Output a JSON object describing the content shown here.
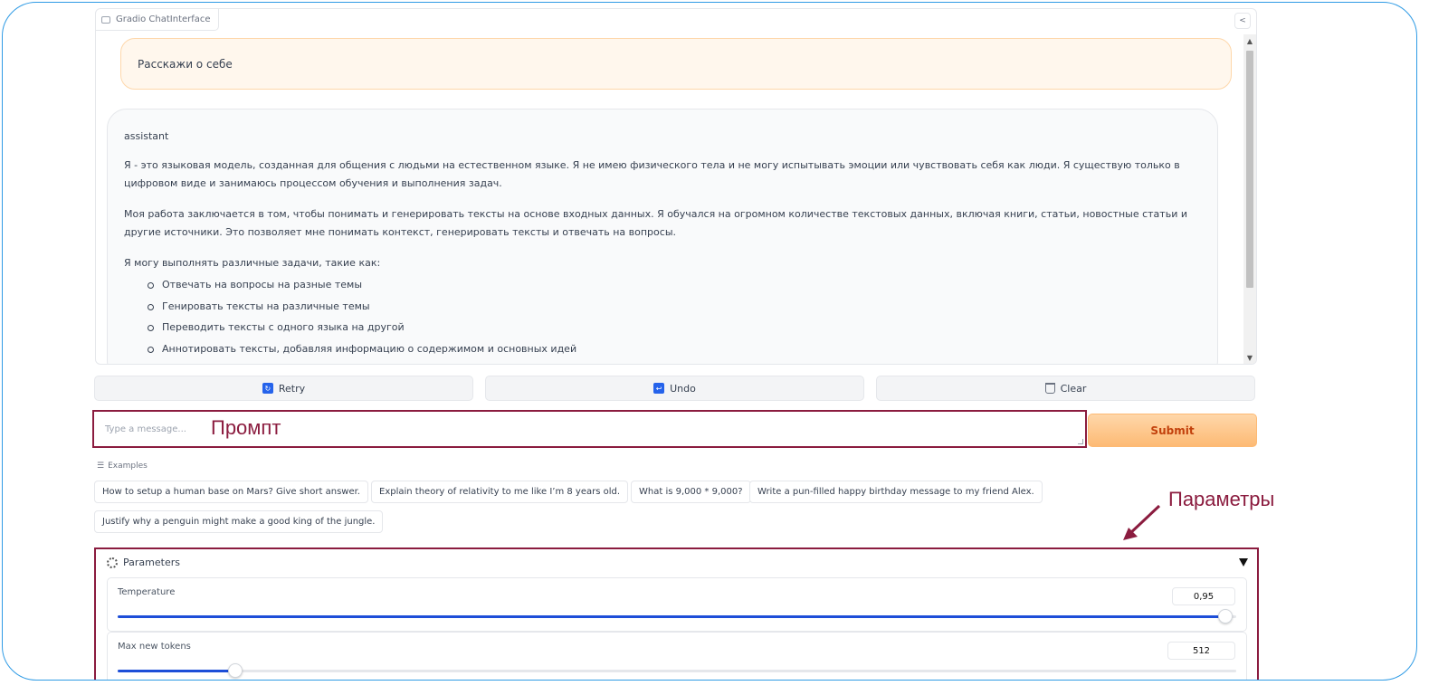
{
  "app": {
    "label": "Gradio ChatInterface"
  },
  "chat": {
    "user_message": "Расскажи о себе",
    "assistant": {
      "role": "assistant",
      "paragraphs": [
        "Я - это языковая модель, созданная для общения с людьми на естественном языке. Я не имею физического тела и не могу испытывать эмоции или чувствовать себя как люди. Я существую только в цифровом виде и занимаюсь процессом обучения и выполнения задач.",
        "Моя работа заключается в том, чтобы понимать и генерировать тексты на основе входных данных. Я обучался на огромном количестве текстовых данных, включая книги, статьи, новостные статьи и другие источники. Это позволяет мне понимать контекст, генерировать тексты и отвечать на вопросы.",
        "Я могу выполнять различные задачи, такие как:"
      ],
      "list": [
        "Отвечать на вопросы на разные темы",
        "Генировать тексты на различные темы",
        "Переводить тексты с одного языка на другой",
        "Аннотировать тексты, добавляя информацию о содержимом и основных идей"
      ]
    }
  },
  "actions": {
    "retry": "Retry",
    "undo": "Undo",
    "clear": "Clear"
  },
  "input": {
    "placeholder": "Type a message...",
    "value": "",
    "submit": "Submit"
  },
  "annotations": {
    "prompt": "Промпт",
    "params": "Параметры"
  },
  "examples": {
    "label": "Examples",
    "items": [
      "How to setup a human base on Mars? Give short answer.",
      "Explain theory of relativity to me like I’m 8 years old.",
      "What is 9,000 * 9,000?",
      "Write a pun-filled happy birthday message to my friend Alex.",
      "Justify why a penguin might make a good king of the jungle."
    ]
  },
  "parameters": {
    "title": "Parameters",
    "temperature": {
      "label": "Temperature",
      "value": "0,95",
      "fraction": 0.99
    },
    "max_new_tokens": {
      "label": "Max new tokens",
      "value": "512",
      "fraction": 0.105
    }
  },
  "colors": {
    "annotation": "#8b1c3f",
    "accent": "#fb923c",
    "slider": "#1d4ed8",
    "frame": "#2f9be5"
  },
  "icons": [
    "chat-icon",
    "share-icon",
    "retry-icon",
    "undo-icon",
    "trash-icon",
    "list-icon",
    "gear-icon",
    "caret-down-icon",
    "arrow-icon"
  ]
}
